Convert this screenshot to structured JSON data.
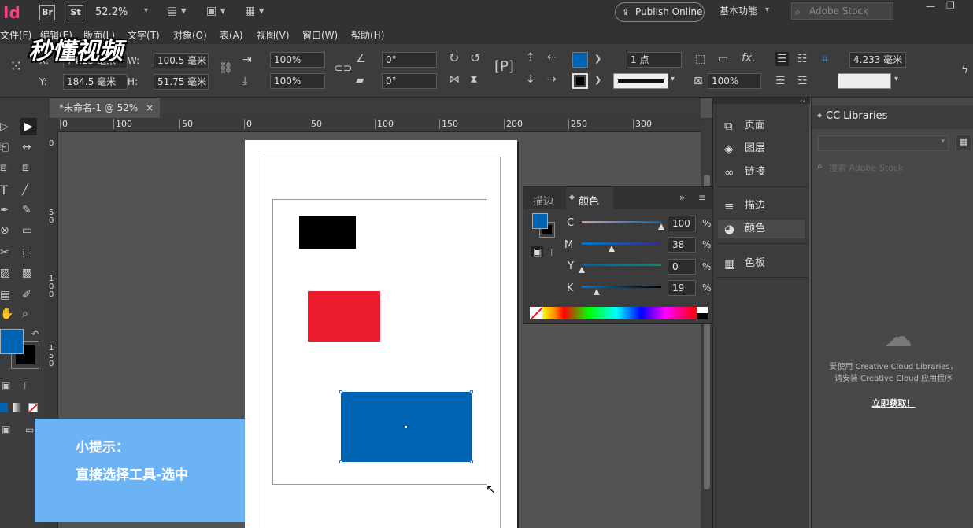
{
  "app": {
    "logo": "Id",
    "br": "Br",
    "st": "St",
    "zoom": "52.2%",
    "publish": "Publish Online",
    "workspace": "基本功能",
    "search_placeholder": "Adobe Stock"
  },
  "menu": {
    "file": "文件(F)",
    "edit": "编辑(E)",
    "layout": "版面(L)",
    "text": "文字(T)",
    "object": "对象(O)",
    "table": "表(A)",
    "view": "视图(V)",
    "window": "窗口(W)",
    "help": "帮助(H)"
  },
  "watermark": "秒懂视频",
  "control": {
    "x_label": "X:",
    "x_value": "74.25 毫米",
    "y_label": "Y:",
    "y_value": "184.5 毫米",
    "w_label": "W:",
    "w_value": "100.5 毫米",
    "h_label": "H:",
    "h_value": "51.75 毫米",
    "scale_x": "100%",
    "scale_y": "100%",
    "rotate": "0°",
    "shear": "0°",
    "stroke_weight": "1 点",
    "opacity": "100%",
    "frame_offset": "4.233 毫米",
    "fill_color": "#0063b1",
    "stroke_color": "#000000"
  },
  "doc_tab": {
    "title": "*未命名-1 @ 52%",
    "close": "×"
  },
  "ruler": {
    "h_marks": [
      "0",
      "100",
      "50",
      "0",
      "50",
      "100",
      "150",
      "200",
      "250",
      "300"
    ],
    "v_marks": [
      "0",
      "50",
      "100",
      "150"
    ]
  },
  "canvas": {
    "black_rect_color": "#000000",
    "red_rect_color": "#ed1c2e",
    "blue_rect_color": "#0063b1"
  },
  "tip": {
    "title": "小提示：",
    "body": "直接选择工具-选中"
  },
  "color_panel": {
    "tab_stroke": "描边",
    "tab_color": "颜色",
    "channels": [
      {
        "label": "C",
        "value": "100",
        "unit": "%",
        "level": 1.0
      },
      {
        "label": "M",
        "value": "38",
        "unit": "%",
        "level": 0.38
      },
      {
        "label": "Y",
        "value": "0",
        "unit": "%",
        "level": 0.0
      },
      {
        "label": "K",
        "value": "19",
        "unit": "%",
        "level": 0.19
      }
    ]
  },
  "side_panels": [
    {
      "label": "页面",
      "icon": "pages-icon"
    },
    {
      "label": "图层",
      "icon": "layers-icon"
    },
    {
      "label": "链接",
      "icon": "links-icon"
    },
    {
      "label": "描边",
      "icon": "stroke-icon"
    },
    {
      "label": "颜色",
      "icon": "color-icon"
    },
    {
      "label": "色板",
      "icon": "swatches-icon"
    }
  ],
  "libraries": {
    "title": "CC Libraries",
    "search_placeholder": "搜索 Adobe Stock",
    "message_line1": "要使用 Creative Cloud Libraries，",
    "message_line2": "请安装 Creative Cloud 应用程序",
    "cta": "立即获取！"
  }
}
